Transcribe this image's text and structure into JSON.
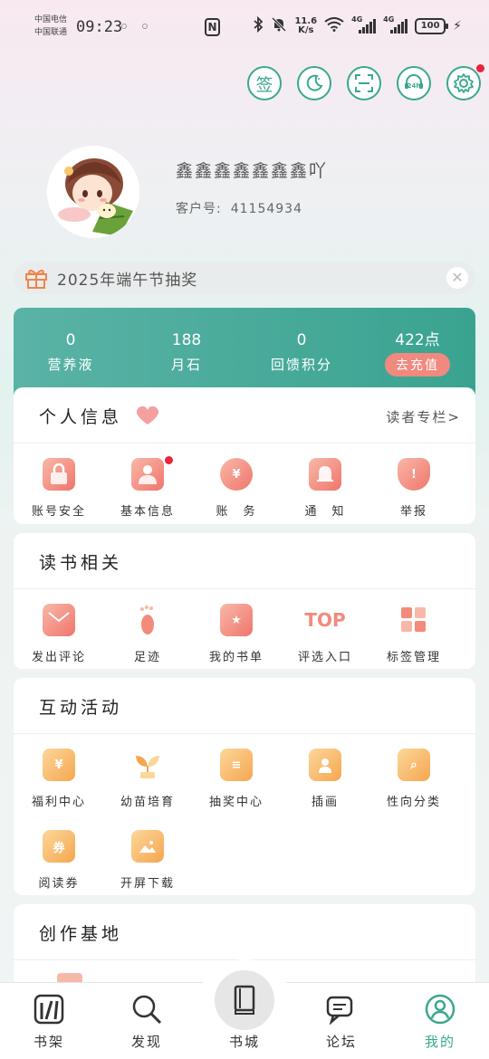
{
  "status_bar": {
    "carrier1": "中国电信",
    "carrier2": "中国联通",
    "time": "09:23",
    "nfc": "N",
    "speed_value": "11.6",
    "speed_unit": "K/s",
    "net1": "4G",
    "net2": "4G",
    "battery": "100"
  },
  "top_icons": {
    "sign_label": "签"
  },
  "profile": {
    "username": "鑫鑫鑫鑫鑫鑫鑫吖",
    "customer_label": "客户号:",
    "customer_no": "41154934"
  },
  "banner": {
    "text": "2025年端午节抽奖"
  },
  "stats": [
    {
      "value": "0",
      "label": "营养液"
    },
    {
      "value": "188",
      "label": "月石"
    },
    {
      "value": "0",
      "label": "回馈积分"
    },
    {
      "value": "422点",
      "label": "去充值"
    }
  ],
  "personal": {
    "title": "个人信息",
    "link": "读者专栏>",
    "items": [
      {
        "label": "账号安全"
      },
      {
        "label": "基本信息"
      },
      {
        "label": "账　务"
      },
      {
        "label": "通　知"
      },
      {
        "label": "举报"
      }
    ]
  },
  "reading": {
    "title": "读书相关",
    "items": [
      {
        "label": "发出评论"
      },
      {
        "label": "足迹"
      },
      {
        "label": "我的书单"
      },
      {
        "label": "评选入口",
        "icon_text": "TOP"
      },
      {
        "label": "标签管理"
      }
    ]
  },
  "activities": {
    "title": "互动活动",
    "items": [
      {
        "label": "福利中心"
      },
      {
        "label": "幼苗培育"
      },
      {
        "label": "抽奖中心"
      },
      {
        "label": "插画"
      },
      {
        "label": "性向分类"
      },
      {
        "label": "阅读券",
        "icon_text": "券"
      },
      {
        "label": "开屏下载"
      }
    ]
  },
  "creation": {
    "title": "创作基地"
  },
  "nav": {
    "items": [
      {
        "label": "书架"
      },
      {
        "label": "发现"
      },
      {
        "label": "书城"
      },
      {
        "label": "论坛"
      },
      {
        "label": "我的"
      }
    ]
  },
  "colors": {
    "accent": "#3aa890",
    "recharge": "#f0897e",
    "badge": "#e8253a"
  }
}
